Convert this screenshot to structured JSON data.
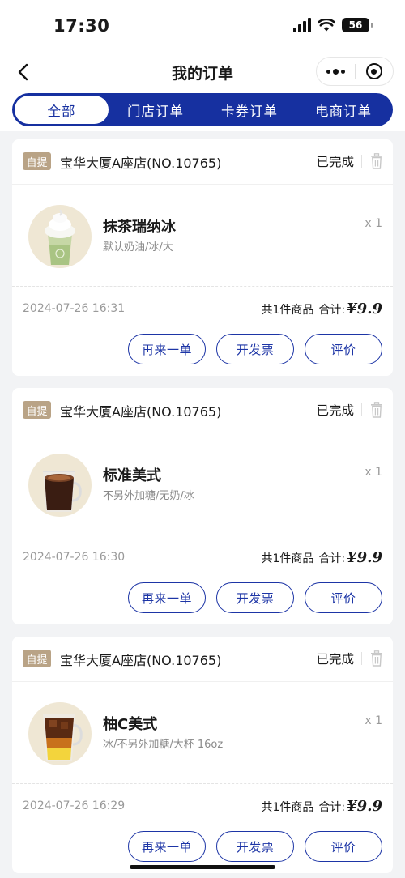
{
  "status_bar": {
    "time": "17:30",
    "battery": "56"
  },
  "nav": {
    "title": "我的订单"
  },
  "tabs": [
    {
      "label": "全部",
      "active": true
    },
    {
      "label": "门店订单",
      "active": false
    },
    {
      "label": "卡券订单",
      "active": false
    },
    {
      "label": "电商订单",
      "active": false
    }
  ],
  "orders": [
    {
      "pickup_tag": "自提",
      "store": "宝华大厦A座店(NO.10765)",
      "status": "已完成",
      "product": {
        "name": "抹茶瑞纳冰",
        "spec": "默认奶油/冰/大",
        "qty": "x 1",
        "image_icon": "matcha-frappe-image"
      },
      "time": "2024-07-26 16:31",
      "count_text": "共1件商品",
      "total_label": "合计:",
      "price": "¥9.9",
      "buttons": {
        "reorder": "再来一单",
        "invoice": "开发票",
        "review": "评价"
      }
    },
    {
      "pickup_tag": "自提",
      "store": "宝华大厦A座店(NO.10765)",
      "status": "已完成",
      "product": {
        "name": "标准美式",
        "spec": "不另外加糖/无奶/冰",
        "qty": "x 1",
        "image_icon": "americano-image"
      },
      "time": "2024-07-26 16:30",
      "count_text": "共1件商品",
      "total_label": "合计:",
      "price": "¥9.9",
      "buttons": {
        "reorder": "再来一单",
        "invoice": "开发票",
        "review": "评价"
      }
    },
    {
      "pickup_tag": "自提",
      "store": "宝华大厦A座店(NO.10765)",
      "status": "已完成",
      "product": {
        "name": "柚C美式",
        "spec": "冰/不另外加糖/大杯 16oz",
        "qty": "x 1",
        "image_icon": "grapefruit-americano-image"
      },
      "time": "2024-07-26 16:29",
      "count_text": "共1件商品",
      "total_label": "合计:",
      "price": "¥9.9",
      "buttons": {
        "reorder": "再来一单",
        "invoice": "开发票",
        "review": "评价"
      }
    }
  ],
  "colors": {
    "brand_blue": "#1630a0",
    "tag_tan": "#b9a386",
    "background": "#f2f3f5"
  }
}
